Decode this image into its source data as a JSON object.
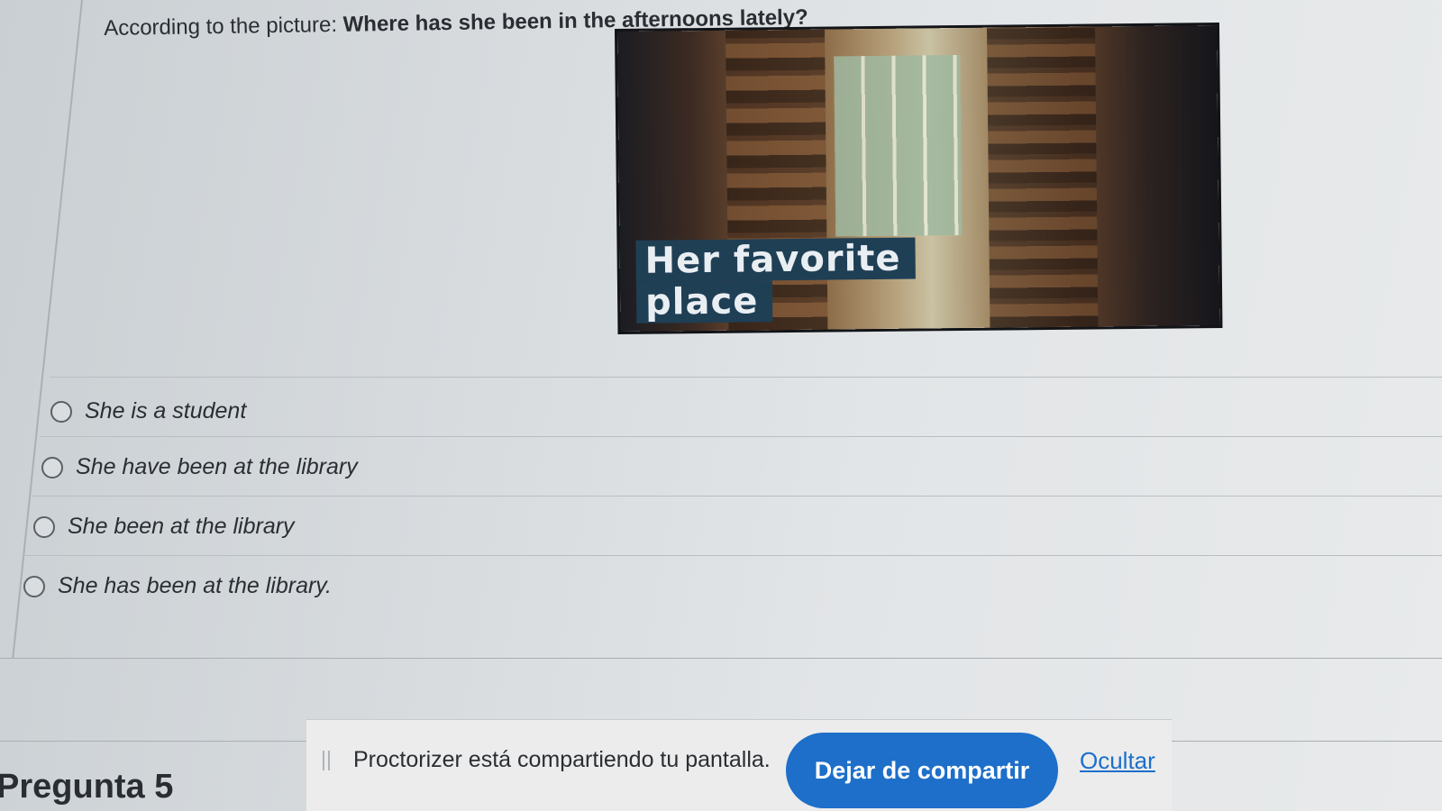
{
  "question": {
    "prefix": "According to the picture: ",
    "text": "Where has she been in the afternoons lately?"
  },
  "picture": {
    "caption_line1": "Her favorite",
    "caption_line2": "place"
  },
  "options": [
    {
      "label": "She is a student"
    },
    {
      "label": "She have been at the library"
    },
    {
      "label": "She been at the library"
    },
    {
      "label": "She has been at the library."
    }
  ],
  "next_question": {
    "label": "Pregunta 5"
  },
  "share_bar": {
    "message": "Proctorizer está compartiendo tu pantalla.",
    "stop_label": "Dejar de compartir",
    "hide_label": "Ocultar"
  },
  "colors": {
    "accent": "#1d6fc9",
    "caption_bg": "#1f3f55"
  },
  "icons": {
    "grip": "drag-handle-icon",
    "radio": "radio-unchecked-icon"
  }
}
